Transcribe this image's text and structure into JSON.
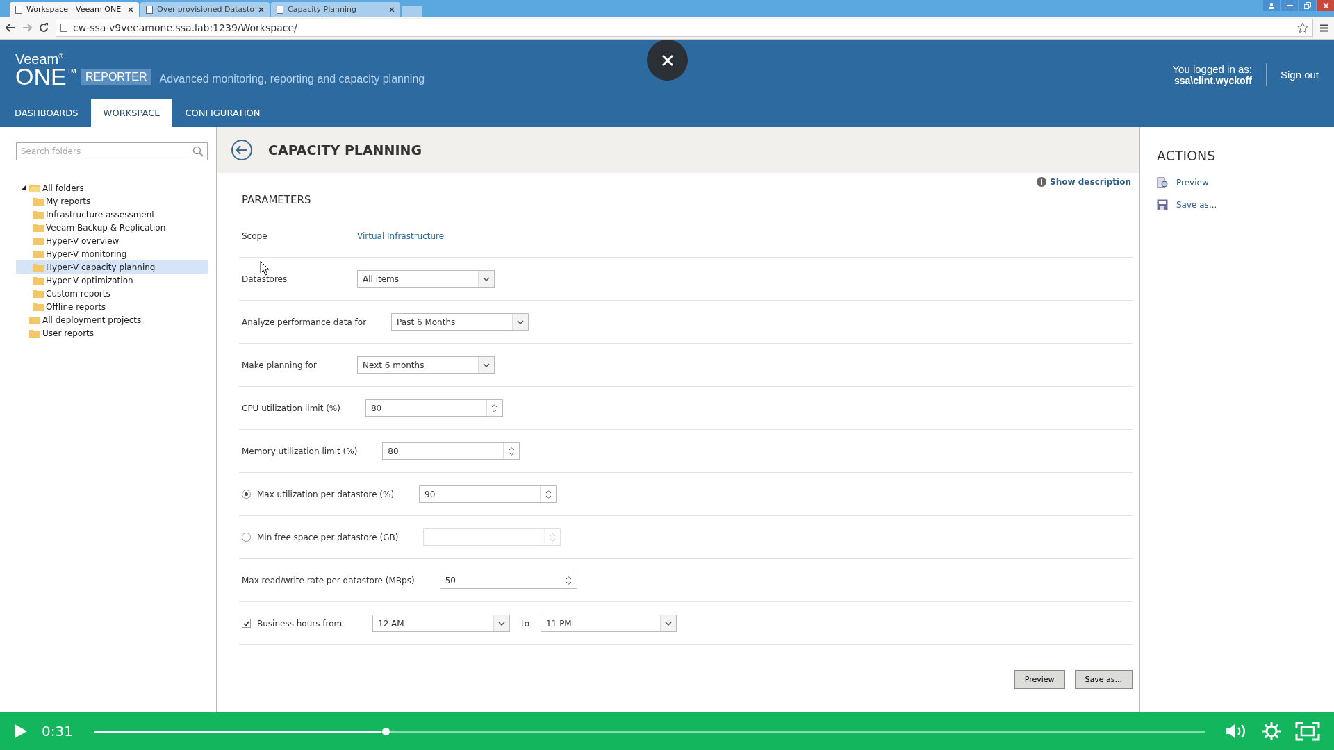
{
  "browser": {
    "tabs": [
      {
        "label": "Workspace - Veeam ONE",
        "selected": true
      },
      {
        "label": "Over-provisioned Datasto",
        "selected": false
      },
      {
        "label": "Capacity Planning",
        "selected": false
      }
    ],
    "address": "cw-ssa-v9veeamone.ssa.lab:1239/Workspace/"
  },
  "header": {
    "logo": {
      "brand": "Veeam$^{®}$",
      "product": "ONE$^{™}$",
      "edition": "REPORTER"
    },
    "tagline": "Advanced monitoring, reporting and capacity planning",
    "user_label": "You logged in as:",
    "user_name": "ssa\\clint.wyckoff",
    "sign_out": "Sign out",
    "nav": [
      {
        "label": "DASHBOARDS",
        "selected": false
      },
      {
        "label": "WORKSPACE",
        "selected": true
      },
      {
        "label": "CONFIGURATION",
        "selected": false
      }
    ]
  },
  "sidebar": {
    "search": {
      "placeholder": "Search folders"
    },
    "tree": [
      {
        "label": "All folders",
        "expanded": true,
        "selected": false,
        "children": [
          {
            "label": "My reports",
            "selected": false
          },
          {
            "label": "Infrastructure assessment",
            "selected": false
          },
          {
            "label": "Veeam Backup & Replication",
            "selected": false
          },
          {
            "label": "Hyper-V overview",
            "selected": false
          },
          {
            "label": "Hyper-V monitoring",
            "selected": false
          },
          {
            "label": "Hyper-V capacity planning",
            "selected": true
          },
          {
            "label": "Hyper-V optimization",
            "selected": false
          },
          {
            "label": "Custom reports",
            "selected": false
          },
          {
            "label": "Offline reports",
            "selected": false
          }
        ]
      },
      {
        "label": "All deployment projects",
        "selected": false
      },
      {
        "label": "User reports",
        "selected": false
      }
    ]
  },
  "page": {
    "title": "CAPACITY PLANNING",
    "show_description": "Show description",
    "section": "PARAMETERS",
    "rows": [
      {
        "kind": "link",
        "label": "Scope",
        "value": "Virtual Infrastructure"
      },
      {
        "kind": "select",
        "label": "Datastores",
        "value": "All items"
      },
      {
        "kind": "select",
        "label": "Analyze performance data for",
        "value": "Past 6 Months"
      },
      {
        "kind": "select",
        "label": "Make planning for",
        "value": "Next 6 months"
      },
      {
        "kind": "spinner",
        "label": "CPU utilization limit (%)",
        "value": "80"
      },
      {
        "kind": "spinner",
        "label": "Memory utilization limit (%)",
        "value": "80"
      },
      {
        "kind": "radio",
        "label": "Max utilization per datastore (%)",
        "selected": true,
        "value": "90",
        "disabled": false
      },
      {
        "kind": "radio",
        "label": "Min free space per datastore (GB)",
        "selected": false,
        "disabled": true
      },
      {
        "kind": "spinner",
        "label": "Max read/write rate per datastore (MBps)",
        "value": "50"
      },
      {
        "kind": "range",
        "label": "Business hours from",
        "checked": true,
        "from": "12 AM",
        "joiner": "to",
        "to": "11 PM"
      }
    ],
    "buttons": [
      "Preview",
      "Save as..."
    ]
  },
  "actions": {
    "title": "ACTIONS",
    "items": [
      "Preview",
      "Save as..."
    ]
  },
  "player": {
    "time": "0:31",
    "level": 0.263
  }
}
